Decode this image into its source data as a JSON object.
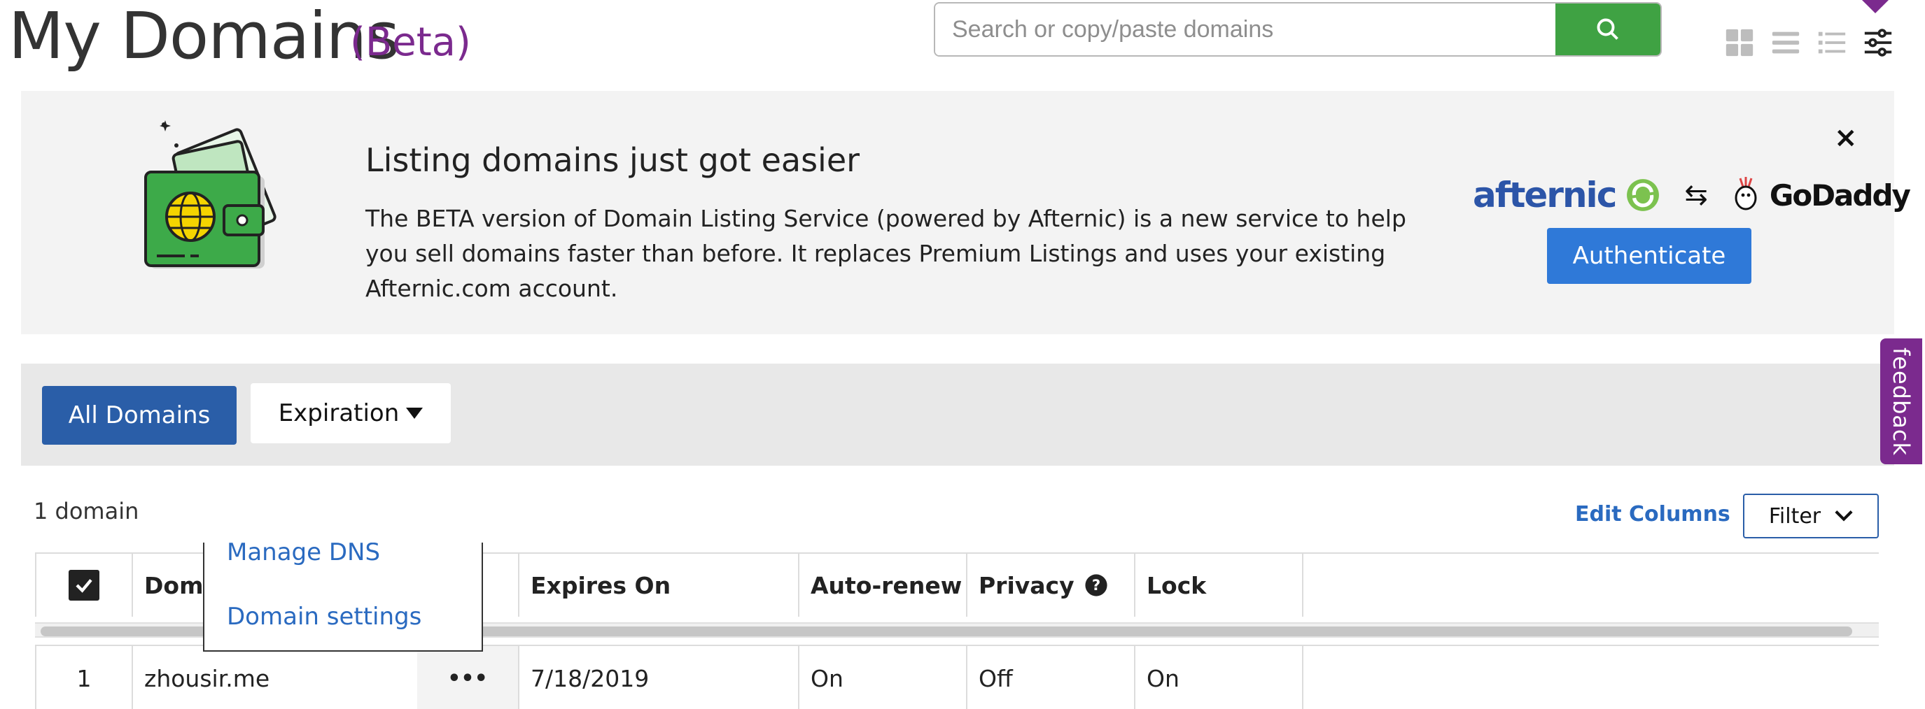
{
  "header": {
    "title": "My Domains",
    "beta": "(Beta)",
    "search_placeholder": "Search or copy/paste domains"
  },
  "view_icons": [
    "grid-view-icon",
    "list-view-icon",
    "compact-list-icon",
    "settings-sliders-icon"
  ],
  "banner": {
    "title": "Listing domains just got easier",
    "body": "The BETA version of Domain Listing Service (powered by Afternic) is a new service to help you sell domains faster than before. It replaces Premium Listings and uses your existing Afternic.com account.",
    "close_label": "×",
    "afternic_logo": "afternic",
    "godaddy_logo": "GoDaddy",
    "swap_symbol": "⇆",
    "authenticate_label": "Authenticate"
  },
  "filters": {
    "all_domains_label": "All Domains",
    "expiration_label": "Expiration"
  },
  "table_meta": {
    "count": "1 domain",
    "edit_columns": "Edit Columns",
    "filter_label": "Filter"
  },
  "table": {
    "columns": [
      "Domai",
      "Expires On",
      "Auto-renew",
      "Privacy",
      "Lock"
    ],
    "rows": [
      {
        "index": "1",
        "domain": "zhousir.me",
        "more": "•••",
        "expires": "7/18/2019",
        "autorenew": "On",
        "privacy": "Off",
        "lock": "On"
      }
    ]
  },
  "dropdown": {
    "items": [
      "Manage DNS",
      "Domain settings"
    ]
  },
  "feedback_label": "feedback",
  "colors": {
    "accent_purple": "#7b2a8e",
    "search_green": "#3fa243",
    "primary_blue": "#2a5ea8",
    "link_blue": "#2a6ac0"
  }
}
